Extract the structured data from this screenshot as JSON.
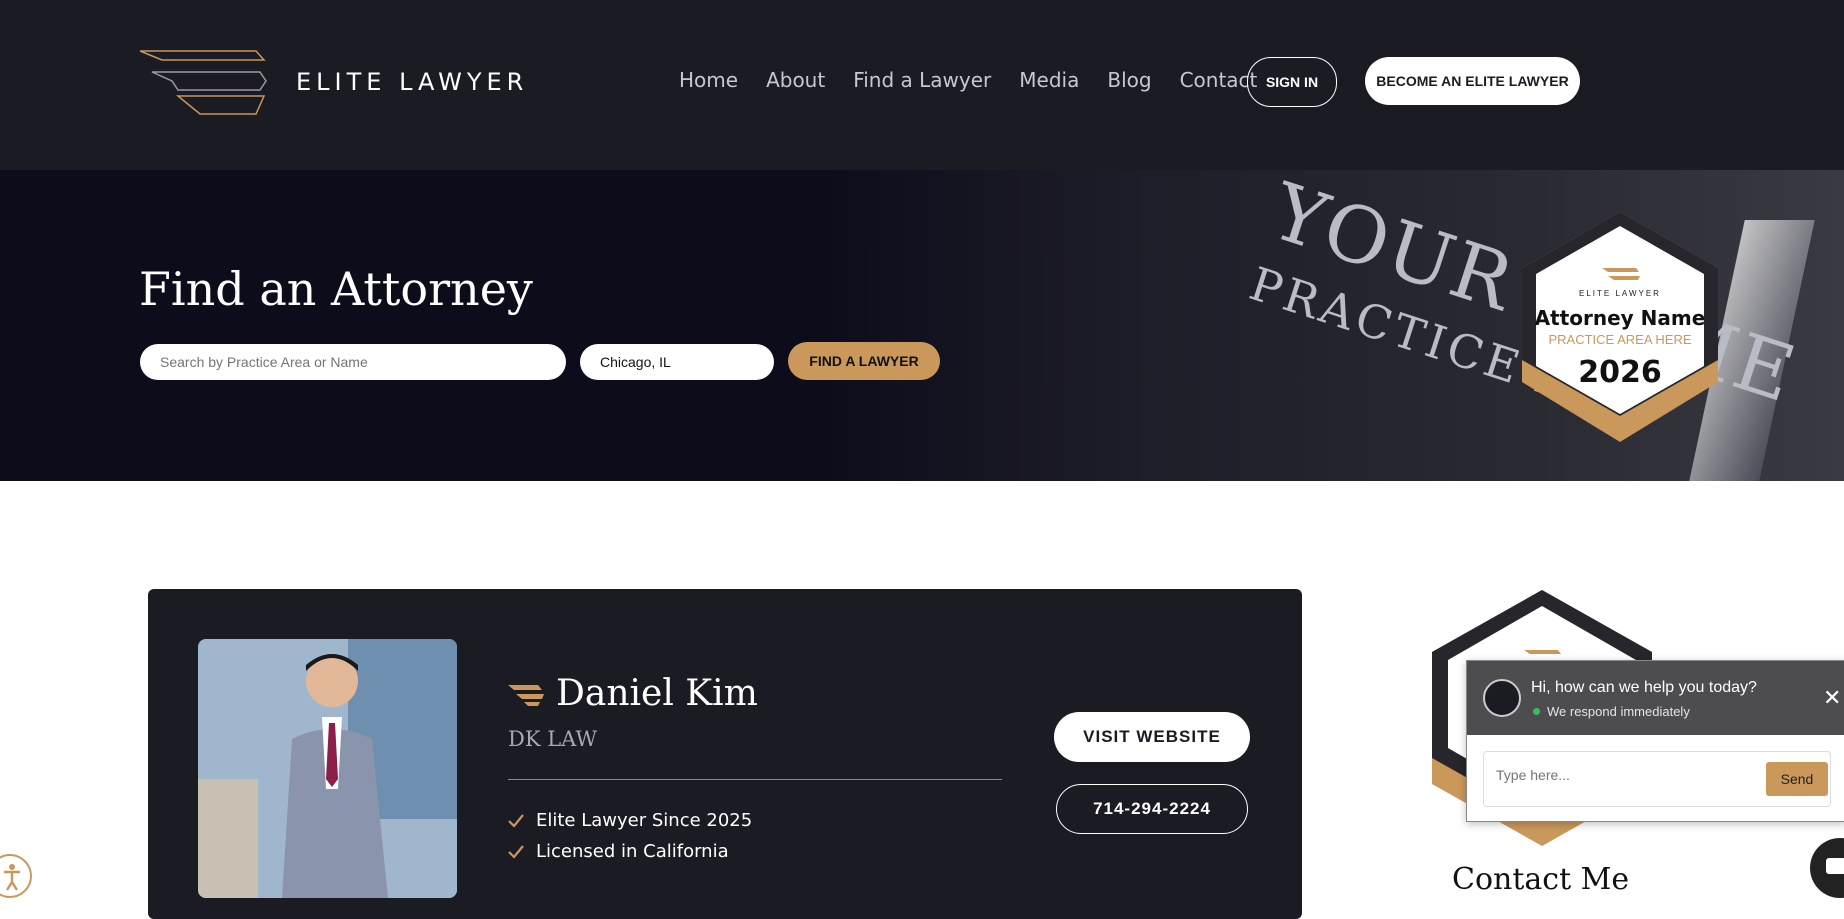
{
  "header": {
    "brand": "ELITE LAWYER",
    "nav": [
      "Home",
      "About",
      "Find a Lawyer",
      "Media",
      "Blog",
      "Contact"
    ],
    "sign_in": "SIGN IN",
    "become": "BECOME AN ELITE LAWYER"
  },
  "hero": {
    "title": "Find an Attorney",
    "search_placeholder": "Search by Practice Area or Name",
    "location_value": "Chicago, IL",
    "find_button": "FIND A LAWYER",
    "plaque_name": "YOUR NAME",
    "plaque_area": "PRACTICE A",
    "badge": {
      "brand": "ELITE LAWYER",
      "name": "Attorney Name",
      "area": "PRACTICE AREA HERE",
      "year": "2026"
    }
  },
  "card": {
    "name": "Daniel Kim",
    "firm": "DK LAW",
    "features": [
      "Elite Lawyer Since 2025",
      "Licensed in California"
    ],
    "visit": "VISIT WEBSITE",
    "phone": "714-294-2224"
  },
  "sidebar": {
    "contact_title": "Contact Me"
  },
  "chat": {
    "title": "Hi, how can we help you today?",
    "subtitle": "We respond immediately",
    "placeholder": "Type here...",
    "send": "Send",
    "close": "✕"
  },
  "colors": {
    "gold": "#c9985a",
    "dark": "#1b1b23",
    "hero_bg": "#0d0c1b"
  }
}
